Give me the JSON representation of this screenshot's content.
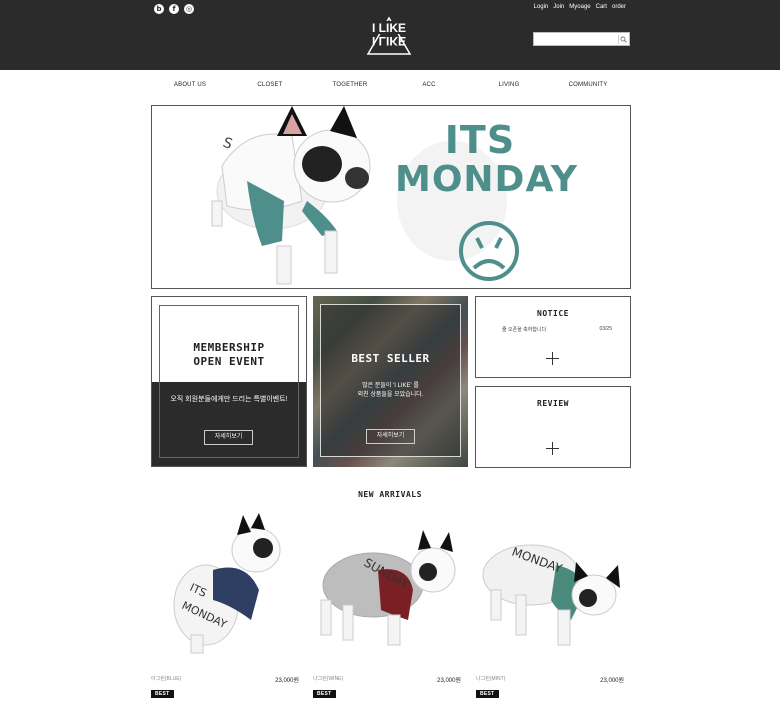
{
  "header": {
    "social": [
      {
        "icon": "blog-icon",
        "glyph": "b"
      },
      {
        "icon": "facebook-icon",
        "glyph": "f"
      },
      {
        "icon": "instagram-icon",
        "glyph": "◎"
      }
    ],
    "top_links": [
      "Login",
      "Join",
      "Myoage",
      "Cart",
      "order"
    ],
    "logo_text_top": "I LIKE",
    "logo_text_bottom": "I LIKE",
    "search": {
      "placeholder": "",
      "value": ""
    }
  },
  "nav": [
    "ABOUT US",
    "CLOSET",
    "TOGETHER",
    "ACC",
    "LIVING",
    "COMMUNITY"
  ],
  "hero": {
    "line1": "ITS",
    "line2": "MONDAY",
    "accent": "#4e8f8c",
    "slides": 5,
    "active_slide": 2
  },
  "membership": {
    "title_line1": "MEMBERSHIP",
    "title_line2": "OPEN EVENT",
    "desc": "오직 회원분들에게만 드리는 특별이벤트!",
    "button": "자세히보기"
  },
  "best_seller": {
    "title": "BEST SELLER",
    "desc_line1": "많은 분들이 'I LIKE' 를",
    "desc_line2": "외친 상품들을 모았습니다.",
    "button": "자세히보기"
  },
  "notice": {
    "title": "NOTICE",
    "rows": [
      {
        "text": "줄 오픈을 축하합니다",
        "date": "03/25"
      }
    ]
  },
  "review": {
    "title": "REVIEW"
  },
  "new_arrivals": {
    "title": "NEW ARRIVALS",
    "products": [
      {
        "name": "아그린(BLUE)",
        "price": "23,000원",
        "badge": "BEST",
        "sleeve": "#2f3f63",
        "shirt_text": "ITS MONDAY"
      },
      {
        "name": "나그린(WINE)",
        "price": "23,000원",
        "badge": "BEST",
        "sleeve": "#7a1f24",
        "shirt_text": "SUNDAY"
      },
      {
        "name": "나그린(MINT)",
        "price": "23,000원",
        "badge": "BEST",
        "sleeve": "#4a8a7c",
        "shirt_text": "MONDAY"
      }
    ]
  }
}
